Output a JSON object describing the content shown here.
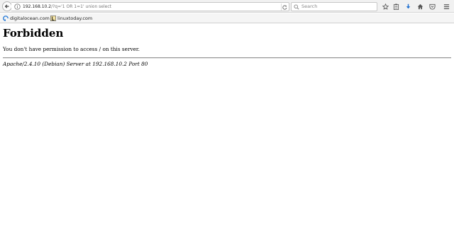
{
  "browser": {
    "url": {
      "host": "192.168.10.2",
      "rest": "/?q='1 OR 1=1' union select"
    },
    "search": {
      "placeholder": "Search"
    },
    "icons": {
      "back": "back-arrow-icon",
      "info": "info-icon",
      "reload": "reload-icon",
      "search": "search-icon",
      "bookmark_star": "bookmark-star-icon",
      "clipboard": "clipboard-icon",
      "download": "download-icon",
      "home": "home-icon",
      "pocket": "pocket-icon",
      "menu": "menu-icon"
    },
    "colors": {
      "download_accent": "#1e6fd1",
      "digitalocean_blue": "#2f7fd8"
    }
  },
  "bookmarks": [
    {
      "label": "digitalocean.com",
      "icon": "digitalocean-icon"
    },
    {
      "label": "linuxtoday.com",
      "icon": "linuxtoday-icon"
    }
  ],
  "page": {
    "title": "Forbidden",
    "message": "You don't have permission to access / on this server.",
    "address": "Apache/2.4.10 (Debian) Server at 192.168.10.2 Port 80"
  }
}
